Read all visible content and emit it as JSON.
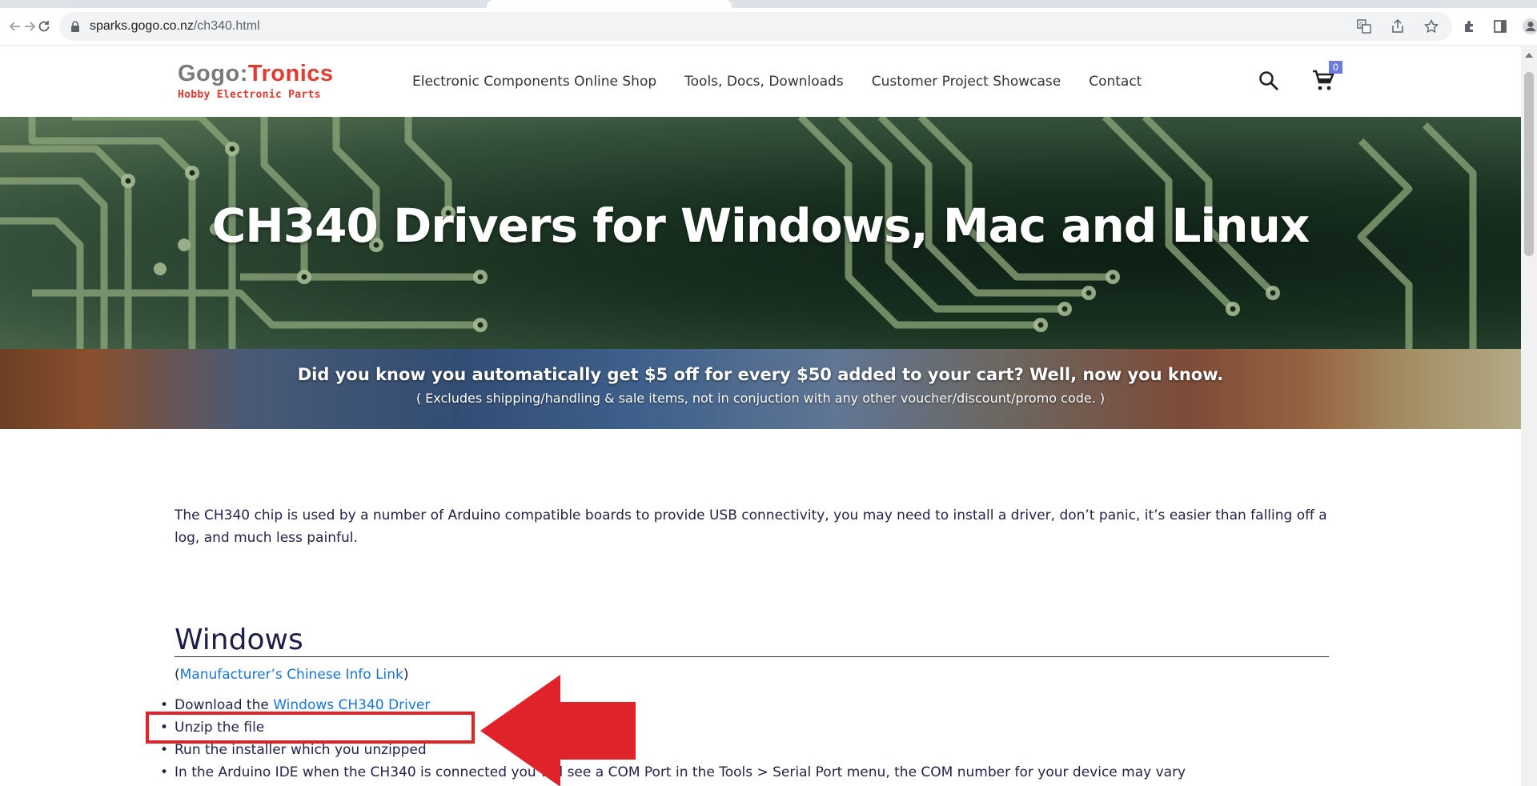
{
  "browser": {
    "url_host": "sparks.gogo.co.nz",
    "url_path": "/ch340.html"
  },
  "site": {
    "logo_part1": "Gogo:",
    "logo_part2": "Tronics",
    "logo_tagline": "Hobby Electronic Parts",
    "nav": [
      {
        "label": "Electronic Components Online Shop"
      },
      {
        "label": "Tools, Docs, Downloads"
      },
      {
        "label": "Customer Project Showcase"
      },
      {
        "label": "Contact"
      }
    ],
    "cart_count": "0"
  },
  "hero": {
    "title": "CH340 Drivers for Windows, Mac and Linux"
  },
  "promo": {
    "headline": "Did you know you automatically get $5 off for every $50 added to your cart? Well, now you know.",
    "subline": "( Excludes shipping/handling & sale items, not in conjuction with any other voucher/discount/promo code. )"
  },
  "content": {
    "intro": "The CH340 chip is used by a number of Arduino compatible boards to provide USB connectivity, you may need to install a driver, don’t panic, it’s easier than falling off a log, and much less painful.",
    "windows_heading": "Windows",
    "mfr_open": "(",
    "mfr_link": "Manufacturer’s Chinese Info Link",
    "mfr_close": ")",
    "steps": {
      "s1_prefix": "Download the ",
      "s1_link": "Windows CH340 Driver",
      "s2": "Unzip the file",
      "s3": "Run the installer which you unzipped",
      "s4": "In the Arduino IDE when the CH340 is connected you will see a COM Port in the Tools > Serial Port menu, the COM number for your device may vary"
    }
  },
  "colors": {
    "accent_red": "#e0222a",
    "link_blue": "#1a73d9",
    "logo_red": "#e23a2e",
    "cart_badge": "#6c7bd9"
  }
}
